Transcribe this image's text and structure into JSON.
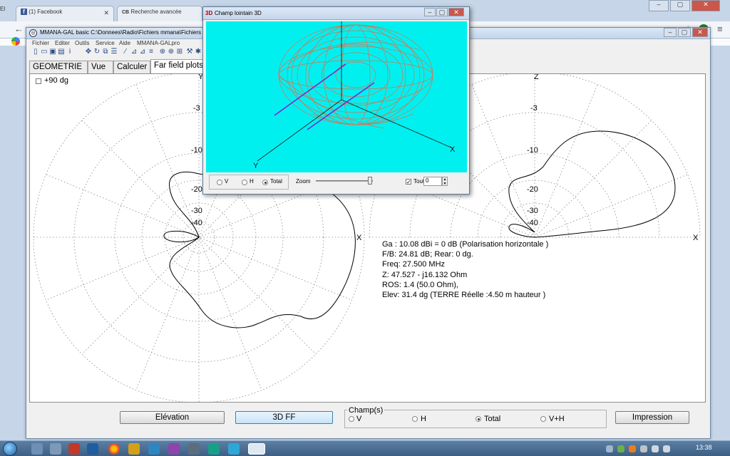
{
  "browser": {
    "tabs": [
      {
        "label": "(1) Facebook"
      },
      {
        "label": "Recherche avancée"
      }
    ],
    "left_edge_text": "El"
  },
  "mmana": {
    "title": "MMANA-GAL basic C:\\Donnees\\Radio\\Fichiers mmana\\Fichiers Mmana",
    "menu": [
      "Fichier",
      "Editer",
      "Outils",
      "Service",
      "Aide",
      "MMANA-GALpro"
    ],
    "tabs": [
      "GEOMETRIE",
      "Vue",
      "Calculer",
      "Far field plots"
    ],
    "active_tab": "Far field plots",
    "checkbox_label": "+90 dg",
    "polar_left": {
      "axis_top": "Y",
      "axis_right": "X",
      "ring_labels": [
        "-3",
        "-10",
        "-20",
        "-30",
        "-40"
      ]
    },
    "polar_right": {
      "axis_top": "Z",
      "axis_right": "X",
      "ring_labels": [
        "-3",
        "-10",
        "-20",
        "-30",
        "-40"
      ]
    },
    "info": [
      "Ga : 10.08 dBi = 0 dB  (Polarisation horizontale )",
      "F/B: 24.81 dB; Rear: 0 dg.",
      "Freq: 27.500 MHz",
      "Z: 47.527 - j16.132 Ohm",
      "ROS: 1.4 (50.0 Ohm),",
      "Elev: 31.4 dg (TERRE Réelle   :4.50 m hauteur )"
    ],
    "buttons": {
      "elevation": "Elévation",
      "ff3d": "3D FF",
      "print": "Impression"
    },
    "champ": {
      "legend": "Champ(s)",
      "options": [
        "V",
        "H",
        "Total",
        "V+H"
      ],
      "selected": "Total"
    }
  },
  "win3d": {
    "badge": "3D",
    "title": "Champ lointain 3D",
    "axis_x": "X",
    "axis_y": "Y",
    "options": [
      "V",
      "H",
      "Total"
    ],
    "selected": "Total",
    "zoom_label": "Zoom",
    "zoom_level": 0.95,
    "tout_label": "Tout",
    "tout_value": "0",
    "colors": {
      "background": "#00f0f0",
      "mesh": "#e0704a",
      "elements": "#7a2bd0"
    }
  },
  "taskbar": {
    "clock": "13:38"
  }
}
